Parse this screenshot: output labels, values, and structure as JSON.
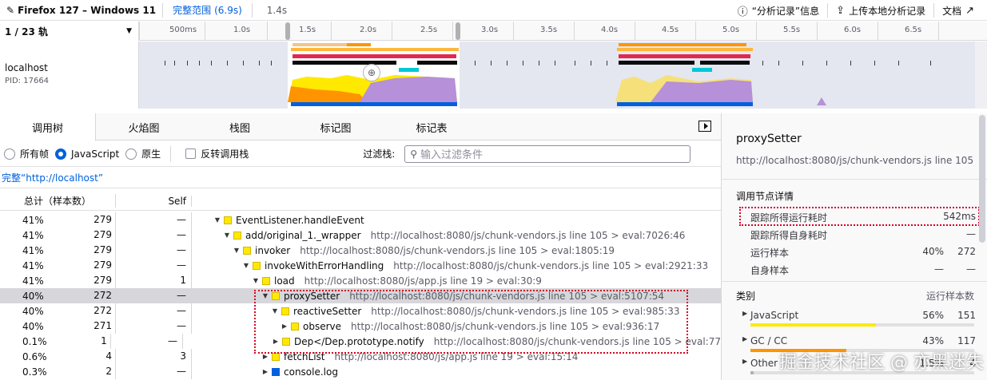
{
  "topbar": {
    "profile_name": "Firefox 127 – Windows 11",
    "range_label": "完整范围",
    "range_duration": "(6.9s)",
    "duration": "1.4s",
    "info_button": "“分析记录”信息",
    "upload_button": "上传本地分析记录",
    "docs_button": "文档"
  },
  "timeline": {
    "track_count": "1 / 23 轨",
    "ticks": [
      "500ms",
      "1.0s",
      "1.5s",
      "2.0s",
      "2.5s",
      "3.0s",
      "3.5s",
      "4.0s",
      "4.5s",
      "5.0s",
      "5.5s",
      "6.0s",
      "6.5s"
    ],
    "track_name": "localhost",
    "track_pid": "PID: 17664"
  },
  "tabs": [
    "调用树",
    "火焰图",
    "栈图",
    "标记图",
    "标记表"
  ],
  "filters": {
    "radio_all": "所有帧",
    "radio_js": "JavaScript",
    "radio_native": "原生",
    "invert_label": "反转调用栈",
    "filter_label": "过滤栈:",
    "search_placeholder": "输入过滤条件"
  },
  "breadcrumb": "完整“http://localhost”",
  "columns": {
    "total": "总计（样本数）",
    "self": "Self"
  },
  "rows": [
    {
      "pct": "41%",
      "count": "279",
      "self": "—",
      "depth": 0,
      "twisty": "▼",
      "cat": "y",
      "name": "EventListener.handleEvent",
      "url": ""
    },
    {
      "pct": "41%",
      "count": "279",
      "self": "—",
      "depth": 1,
      "twisty": "▼",
      "cat": "y",
      "name": "add/original_1._wrapper",
      "url": "http://localhost:8080/js/chunk-vendors.js line 105 > eval:7026:46"
    },
    {
      "pct": "41%",
      "count": "279",
      "self": "—",
      "depth": 2,
      "twisty": "▼",
      "cat": "y",
      "name": "invoker",
      "url": "http://localhost:8080/js/chunk-vendors.js line 105 > eval:1805:19"
    },
    {
      "pct": "41%",
      "count": "279",
      "self": "—",
      "depth": 3,
      "twisty": "▼",
      "cat": "y",
      "name": "invokeWithErrorHandling",
      "url": "http://localhost:8080/js/chunk-vendors.js line 105 > eval:2921:33"
    },
    {
      "pct": "41%",
      "count": "279",
      "self": "1",
      "depth": 4,
      "twisty": "▼",
      "cat": "y",
      "name": "load",
      "url": "http://localhost:8080/js/app.js line 19 > eval:30:9"
    },
    {
      "pct": "40%",
      "count": "272",
      "self": "—",
      "depth": 5,
      "twisty": "▼",
      "cat": "y",
      "name": "proxySetter",
      "url": "http://localhost:8080/js/chunk-vendors.js line 105 > eval:5107:54",
      "selected": true
    },
    {
      "pct": "40%",
      "count": "272",
      "self": "—",
      "depth": 6,
      "twisty": "▼",
      "cat": "y",
      "name": "reactiveSetter",
      "url": "http://localhost:8080/js/chunk-vendors.js line 105 > eval:985:33"
    },
    {
      "pct": "40%",
      "count": "271",
      "self": "—",
      "depth": 7,
      "twisty": "▶",
      "cat": "y",
      "name": "observe",
      "url": "http://localhost:8080/js/chunk-vendors.js line 105 > eval:936:17"
    },
    {
      "pct": "0.1%",
      "count": "1",
      "self": "—",
      "depth": 7,
      "twisty": "▶",
      "cat": "y",
      "name": "Dep</Dep.prototype.notify",
      "url": "http://localhost:8080/js/chunk-vendors.js line 105 > eval:77"
    },
    {
      "pct": "0.6%",
      "count": "4",
      "self": "3",
      "depth": 5,
      "twisty": "▶",
      "cat": "y",
      "name": "fetchList",
      "url": "http://localhost:8080/js/app.js line 19 > eval:15:14"
    },
    {
      "pct": "0.3%",
      "count": "2",
      "self": "—",
      "depth": 5,
      "twisty": "▶",
      "cat": "b",
      "name": "console.log",
      "url": ""
    }
  ],
  "sidebar": {
    "title": "proxySetter",
    "url": "http://localhost:8080/js/chunk-vendors.js line 105",
    "details_heading": "调用节点详情",
    "traced_running": {
      "label": "跟踪所得运行耗时",
      "value": "542ms"
    },
    "traced_self": {
      "label": "跟踪所得自身耗时",
      "value": "—"
    },
    "running_samples": {
      "label": "运行样本",
      "pct": "40%",
      "count": "272"
    },
    "self_samples": {
      "label": "自身样本",
      "pct": "—",
      "count": "—"
    },
    "category_heading": "类别",
    "category_col": "运行样本数",
    "categories": [
      {
        "name": "JavaScript",
        "pct": "56%",
        "count": "151",
        "fill": 0.56,
        "color": "#ffe900"
      },
      {
        "name": "GC / CC",
        "pct": "43%",
        "count": "117",
        "fill": 0.43,
        "color": "#ff9400"
      },
      {
        "name": "Other",
        "pct": "1.5%",
        "count": "4",
        "fill": 0.015,
        "color": "#b1b1b3"
      }
    ]
  },
  "watermark": "掘金技术社区 @ 亦黑迷失"
}
